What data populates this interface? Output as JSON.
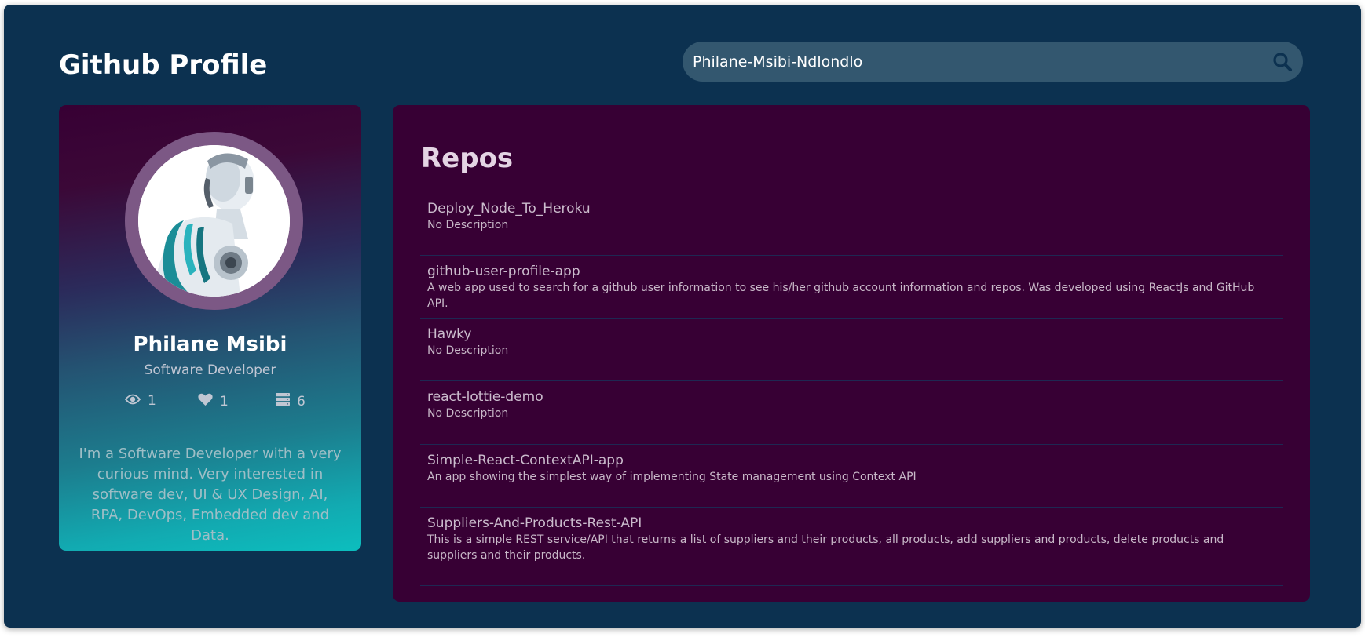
{
  "header": {
    "title": "Github Profile"
  },
  "search": {
    "value": "Philane-Msibi-Ndlondlo",
    "icon": "search-icon"
  },
  "profile": {
    "name": "Philane Msibi",
    "role": "Software Developer",
    "stats": {
      "watchers": "1",
      "favorites": "1",
      "repos": "6"
    },
    "bio": "I'm a Software Developer with a very curious mind. Very interested in software dev, UI & UX Design, AI, RPA, DevOps, Embedded dev and Data."
  },
  "repos": {
    "title": "Repos",
    "items": [
      {
        "name": "Deploy_Node_To_Heroku",
        "description": "No Description"
      },
      {
        "name": "github-user-profile-app",
        "description": "A web app used to search for a github user information to see his/her github account information and repos. Was developed using ReactJs and GitHub API."
      },
      {
        "name": "Hawky",
        "description": "No Description"
      },
      {
        "name": "react-lottie-demo",
        "description": "No Description"
      },
      {
        "name": "Simple-React-ContextAPI-app",
        "description": "An app showing the simplest way of implementing State management using Context API"
      },
      {
        "name": "Suppliers-And-Products-Rest-API",
        "description": "This is a simple REST service/API that returns a list of suppliers and their products, all products, add suppliers and products, delete products and suppliers and their products."
      }
    ]
  },
  "colors": {
    "background": "#0c3150",
    "panel": "#370034",
    "search": "#33576f",
    "accent_teal": "#0cbebe",
    "avatar_ring": "#7c5885"
  }
}
